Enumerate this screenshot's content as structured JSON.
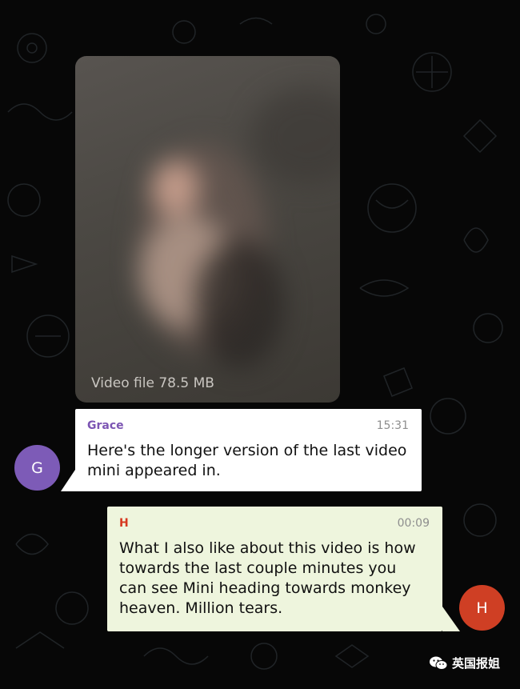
{
  "video": {
    "caption": "Video file 78.5 MB"
  },
  "messages": [
    {
      "sender": "Grace",
      "time": "15:31",
      "text": "Here's the longer version of the last video\nmini appeared in.",
      "avatar_initial": "G",
      "sender_color": "#7c55b3",
      "avatar_color": "#7d5bb7"
    },
    {
      "sender": "H",
      "time": "00:09",
      "text": "What I also like about this video is how\ntowards the last couple minutes you\ncan see Mini heading towards monkey\nheaven. Million tears.",
      "avatar_initial": "H",
      "sender_color": "#d6381f",
      "avatar_color": "#cf3f24"
    }
  ],
  "watermark": {
    "text": "英国报姐",
    "icon": "wechat-icon"
  },
  "colors": {
    "background": "#070707",
    "incoming_bubble": "#ffffff",
    "outgoing_bubble": "#eef5dd"
  }
}
